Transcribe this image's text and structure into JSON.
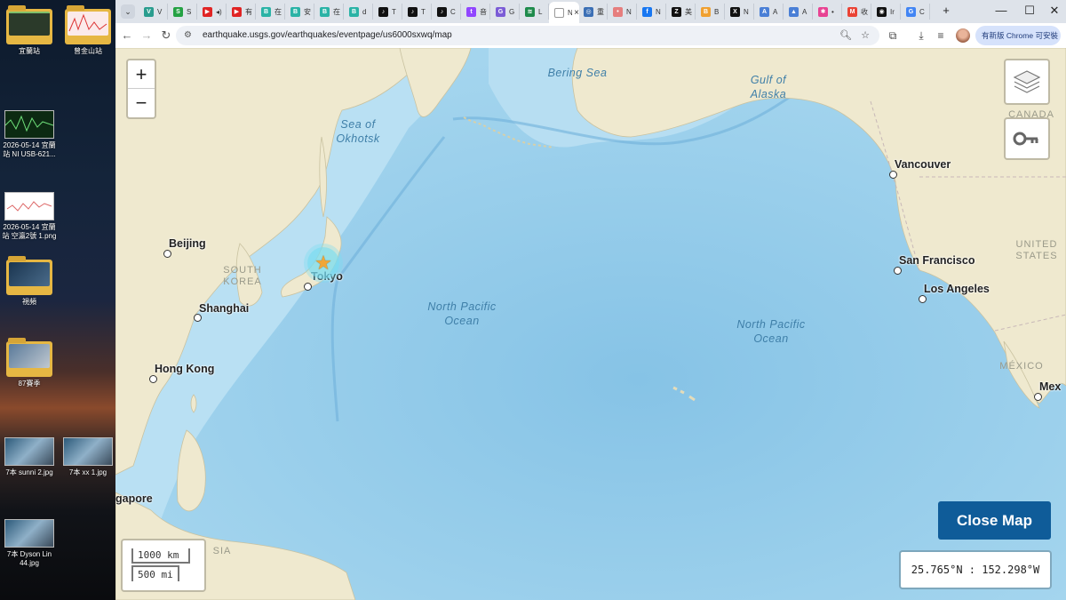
{
  "desktop": {
    "items": [
      {
        "label": "宜蘭站",
        "kind": "folder",
        "icon": "folder-icon"
      },
      {
        "label": "曾金山站",
        "kind": "folder",
        "icon": "folder-icon"
      },
      {
        "label": "2026-05-14 宜蘭站 NI USB-621...",
        "kind": "image",
        "icon": "image-thumbnail-icon"
      },
      {
        "label": "2026-05-14 宜蘭站 空瀛2號 1.png",
        "kind": "image",
        "icon": "image-thumbnail-icon"
      },
      {
        "label": "視頻",
        "kind": "folder",
        "icon": "folder-icon"
      },
      {
        "label": "87賽季",
        "kind": "folder",
        "icon": "folder-icon"
      },
      {
        "label": "7本 sunni 2.jpg",
        "kind": "image",
        "icon": "image-thumbnail-icon"
      },
      {
        "label": "7本 xx 1.jpg",
        "kind": "image",
        "icon": "image-thumbnail-icon"
      },
      {
        "label": "7本 Dyson Lin 44.jpg",
        "kind": "image",
        "icon": "image-thumbnail-icon"
      }
    ]
  },
  "browser": {
    "tab_list_icon": "⌄",
    "tabs": [
      {
        "label": "V",
        "icon_color": "#2a9d8f",
        "glyph": "V"
      },
      {
        "label": "S",
        "icon_color": "#25a244",
        "glyph": "S"
      },
      {
        "label": "◂)",
        "icon_color": "#e02424",
        "glyph": "▶"
      },
      {
        "label": "有",
        "icon_color": "#e02424",
        "glyph": "▶"
      },
      {
        "label": "在",
        "icon_color": "#2ab3a6",
        "glyph": "B"
      },
      {
        "label": "安",
        "icon_color": "#2ab3a6",
        "glyph": "B"
      },
      {
        "label": "在",
        "icon_color": "#2ab3a6",
        "glyph": "B"
      },
      {
        "label": "d",
        "icon_color": "#2ab3a6",
        "glyph": "B"
      },
      {
        "label": "T",
        "icon_color": "#111111",
        "glyph": "♪"
      },
      {
        "label": "T",
        "icon_color": "#111111",
        "glyph": "♪"
      },
      {
        "label": "C",
        "icon_color": "#111111",
        "glyph": "♪"
      },
      {
        "label": "音",
        "icon_color": "#9146ff",
        "glyph": "t"
      },
      {
        "label": "G",
        "icon_color": "#7b5cd6",
        "glyph": "G"
      },
      {
        "label": "L",
        "icon_color": "#1f8b4c",
        "glyph": "≋"
      },
      {
        "label": "N",
        "icon_color": "#ffffff",
        "glyph": "",
        "active": true
      },
      {
        "label": "重",
        "icon_color": "#3b6fb5",
        "glyph": "◎"
      },
      {
        "label": "N",
        "icon_color": "#e67e7e",
        "glyph": "•"
      },
      {
        "label": "N",
        "icon_color": "#1877f2",
        "glyph": "f"
      },
      {
        "label": "美",
        "icon_color": "#111111",
        "glyph": "Z"
      },
      {
        "label": "B",
        "icon_color": "#f0a030",
        "glyph": "B"
      },
      {
        "label": "N",
        "icon_color": "#111111",
        "glyph": "X"
      },
      {
        "label": "A",
        "icon_color": "#4a7fd6",
        "glyph": "A"
      },
      {
        "label": "A",
        "icon_color": "#4a7fd6",
        "glyph": "▲"
      },
      {
        "label": "•",
        "icon_color": "#e84393",
        "glyph": "✱"
      },
      {
        "label": "收",
        "icon_color": "#ea4335",
        "glyph": "M"
      },
      {
        "label": "Ir",
        "icon_color": "#111111",
        "glyph": "◉"
      },
      {
        "label": "C",
        "icon_color": "#4285f4",
        "glyph": "G"
      }
    ],
    "new_tab_icon": "+",
    "window_controls": {
      "minimize": "—",
      "maximize": "☐",
      "close": "✕"
    },
    "toolbar": {
      "back_icon": "←",
      "forward_icon": "→",
      "reload_icon": "↻",
      "url": "earthquake.usgs.gov/earthquakes/eventpage/us6000sxwq/map",
      "update_button": "有新版 Chrome 可安裝"
    }
  },
  "map": {
    "zoom_in": "+",
    "zoom_out": "−",
    "close_button": "Close Map",
    "coordinates": "25.765°N : 152.298°W",
    "scale_km": "1000 km",
    "scale_mi": "500 mi",
    "cities": [
      {
        "name": "Beijing"
      },
      {
        "name": "Tokyo"
      },
      {
        "name": "Shanghai"
      },
      {
        "name": "Hong Kong"
      },
      {
        "name": "Vancouver"
      },
      {
        "name": "San Francisco"
      },
      {
        "name": "Los Angeles"
      },
      {
        "name": "Mex"
      },
      {
        "name": "gapore"
      }
    ],
    "seas": [
      {
        "name": "Bering Sea"
      },
      {
        "name": "Gulf of\nAlaska"
      },
      {
        "name": "Sea of\nOkhotsk"
      },
      {
        "name": "North Pacific\nOcean"
      },
      {
        "name": "North Pacific\nOcean"
      }
    ],
    "regions": [
      {
        "name": "SOUTH\nKOREA"
      },
      {
        "name": "UNITED\nSTATES"
      },
      {
        "name": "CANADA"
      },
      {
        "name": "MÉXICO"
      },
      {
        "name": "SIA"
      }
    ],
    "colors": {
      "land": "#efe9cf",
      "ocean": "#a8d7ef",
      "deep_ocean": "#8cc6e8",
      "accent": "#0f5c99"
    }
  }
}
